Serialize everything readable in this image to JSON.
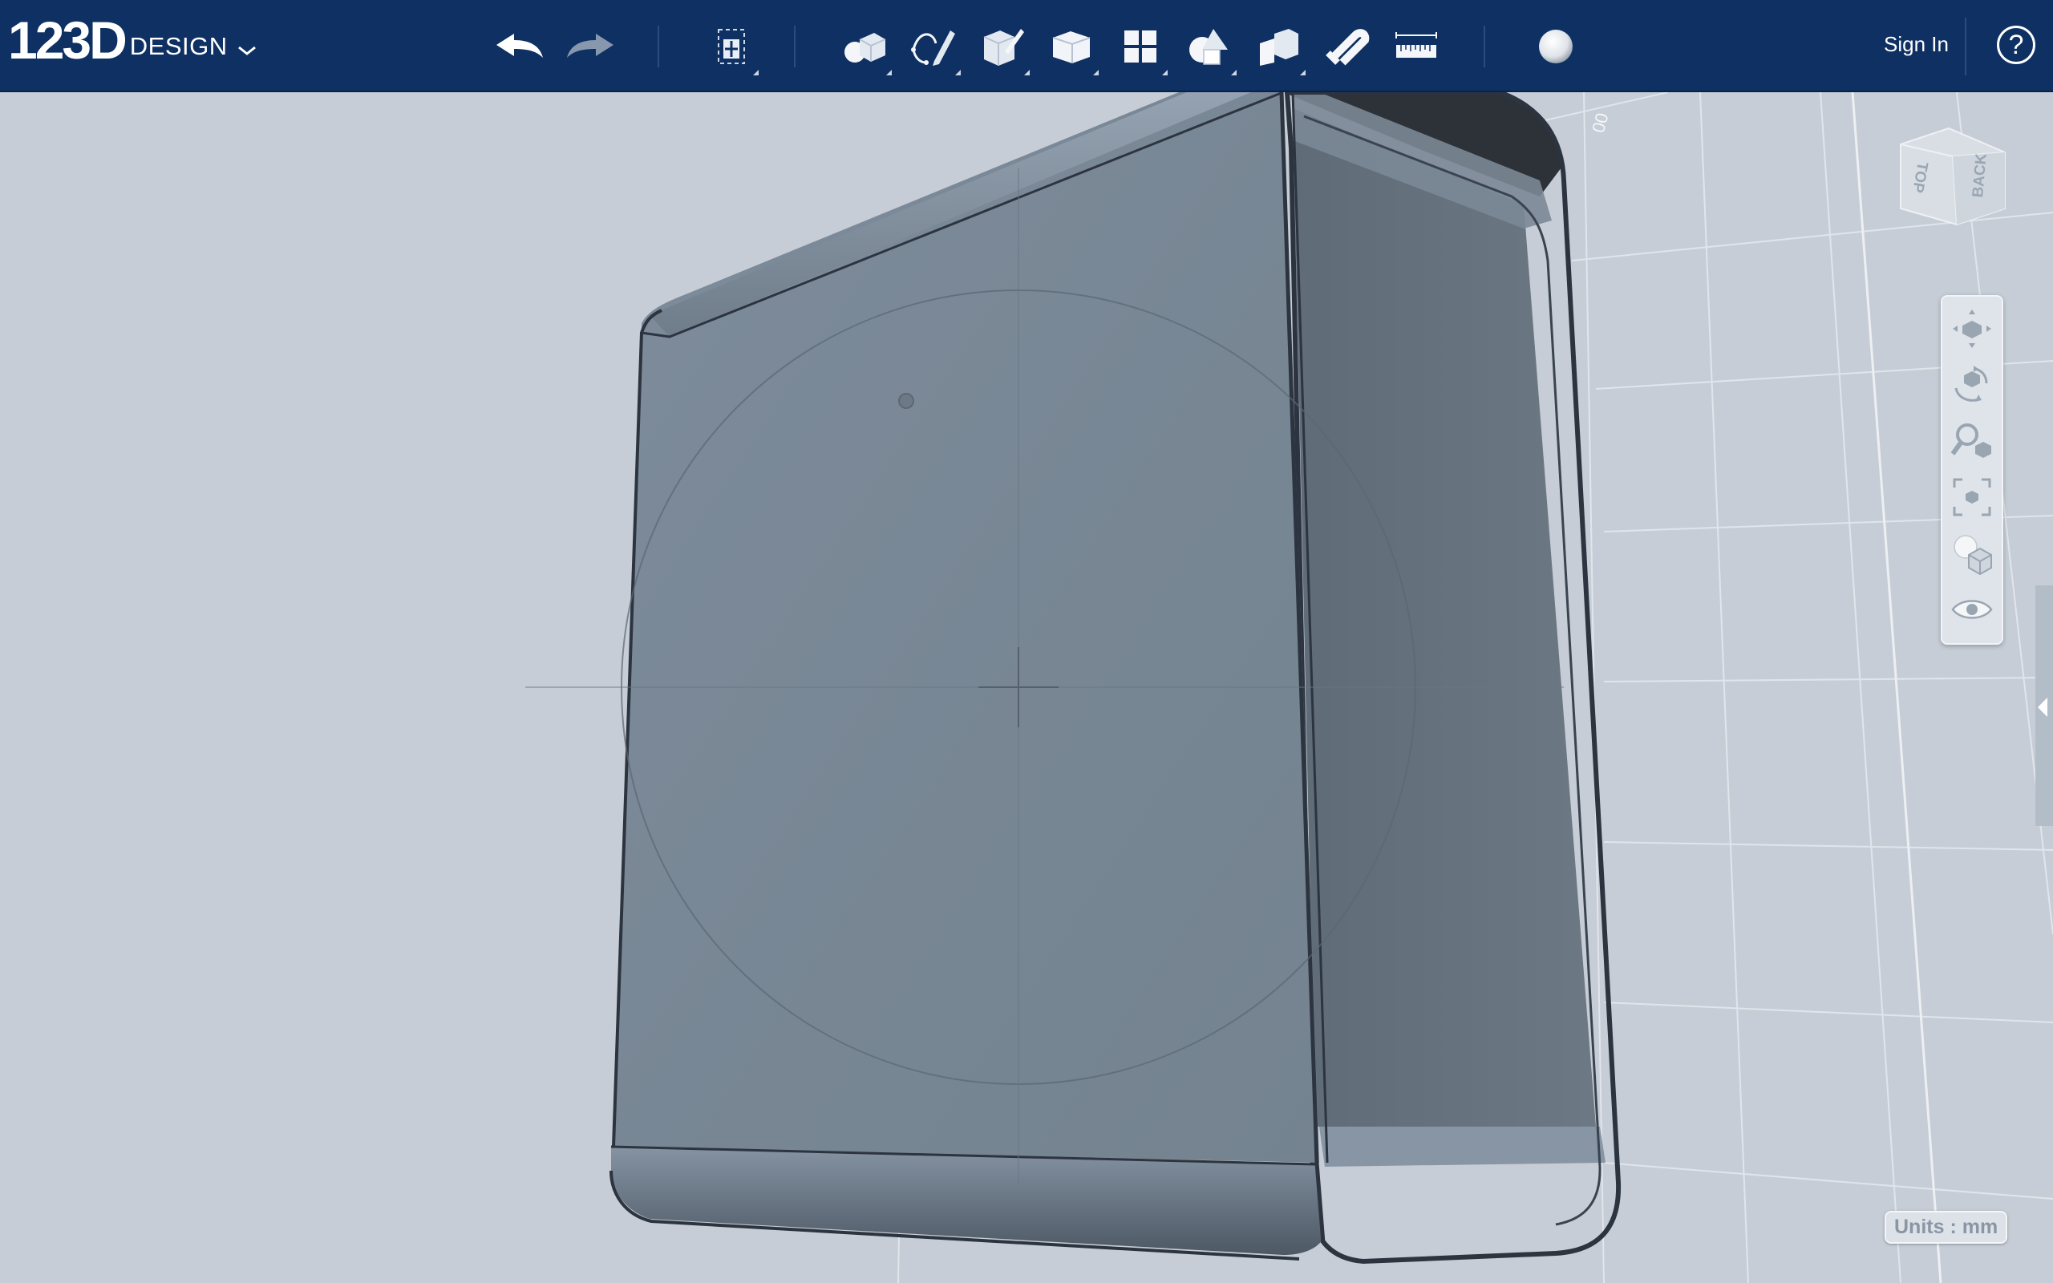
{
  "app": {
    "logo": "123D",
    "product_name": "DESIGN"
  },
  "toolbar": {
    "buttons": [
      {
        "name": "undo",
        "icon": "undo-arrow-icon"
      },
      {
        "name": "redo",
        "icon": "redo-arrow-icon"
      },
      {
        "name": "transform",
        "icon": "transform-icon"
      },
      {
        "name": "primitives",
        "icon": "primitives-icon"
      },
      {
        "name": "sketch",
        "icon": "sketch-pencil-icon"
      },
      {
        "name": "construct",
        "icon": "construct-icon"
      },
      {
        "name": "modify",
        "icon": "modify-cube-icon"
      },
      {
        "name": "pattern",
        "icon": "pattern-grid-icon"
      },
      {
        "name": "grouping",
        "icon": "grouping-shapes-icon"
      },
      {
        "name": "combine",
        "icon": "combine-icon"
      },
      {
        "name": "snap",
        "icon": "snap-magnet-icon"
      },
      {
        "name": "measure",
        "icon": "measure-ruler-icon"
      },
      {
        "name": "material",
        "icon": "material-sphere-icon"
      }
    ],
    "sign_in": "Sign In",
    "help": "?"
  },
  "viewcube": {
    "top_label": "TOP",
    "back_label": "BACK"
  },
  "navbar": {
    "buttons": [
      "pan-icon",
      "orbit-icon",
      "zoom-icon",
      "fit-icon",
      "visual-style-icon",
      "visibility-eye-icon"
    ]
  },
  "status": {
    "units": "Units : mm"
  },
  "colors": {
    "toolbar_bg": "#0f3062",
    "viewport_bg": "#c6cdd6",
    "model_front": "#7a8898",
    "model_inner": "#67737f"
  }
}
